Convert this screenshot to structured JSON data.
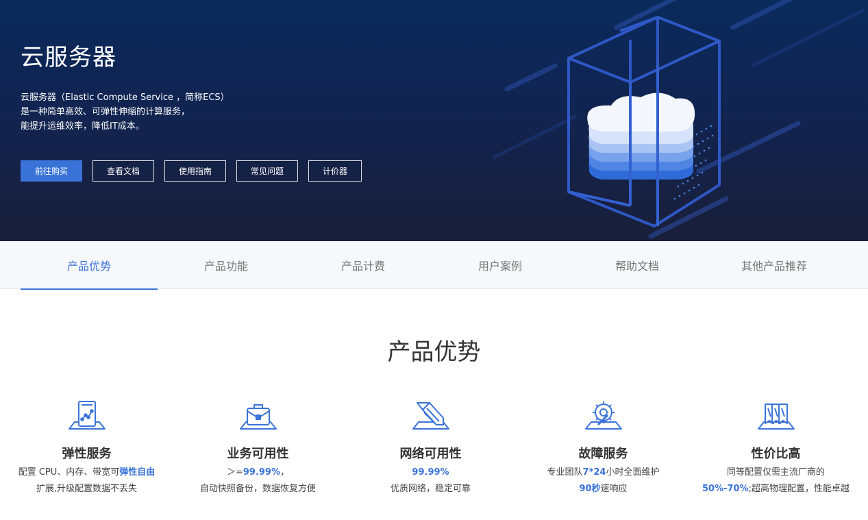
{
  "hero": {
    "title": "云服务器",
    "desc_lines": [
      "云服务器（Elastic Compute Service ，简称ECS）",
      "是一种简单高效、可弹性伸缩的计算服务，",
      "能提升运维效率，降低IT成本。"
    ],
    "buttons": [
      "前往购买",
      "查看文档",
      "使用指南",
      "常见问题",
      "计价器"
    ]
  },
  "tabs": [
    "产品优势",
    "产品功能",
    "产品计费",
    "用户案例",
    "帮助文档",
    "其他产品推荐"
  ],
  "active_tab": "产品优势",
  "section": {
    "title": "产品优势"
  },
  "features": [
    {
      "icon": "elastic-chart-icon",
      "name": "弹性服务",
      "line1": {
        "pre": "配置 CPU、内存、带宽可",
        "hl": "弹性自由",
        "post": ""
      },
      "line2": {
        "pre": "扩展,升级配置数据不丢失",
        "hl": "",
        "post": ""
      }
    },
    {
      "icon": "briefcase-icon",
      "name": "业务可用性",
      "line1": {
        "pre": "＞=",
        "hl": "99.99%",
        "post": "，"
      },
      "line2": {
        "pre": "自动快照备份，数据恢复方便",
        "hl": "",
        "post": ""
      }
    },
    {
      "icon": "network-tool-icon",
      "name": "网络可用性",
      "line1": {
        "pre": "",
        "hl": "99.99%",
        "post": ""
      },
      "line2": {
        "pre": "优质网络，稳定可靠",
        "hl": "",
        "post": ""
      }
    },
    {
      "icon": "gear-wrench-icon",
      "name": "故障服务",
      "line1": {
        "pre": "专业团队",
        "hl": "7*24",
        "post": "小时全面维护"
      },
      "line2": {
        "pre": "",
        "hl": "90秒",
        "post": "速响应"
      }
    },
    {
      "icon": "value-cards-icon",
      "name": "性价比高",
      "line1": {
        "pre": "同等配置仅需主流厂商的",
        "hl": "",
        "post": ""
      },
      "line2": {
        "pre": "",
        "hl": "50%-70%",
        "post": ";超高物理配置，性能卓越"
      }
    }
  ],
  "colors": {
    "accent": "#3a73d8",
    "hero_top": "#0a2a5c",
    "hero_bottom": "#1a1f3a",
    "tab_bg": "#f7f8fb"
  }
}
